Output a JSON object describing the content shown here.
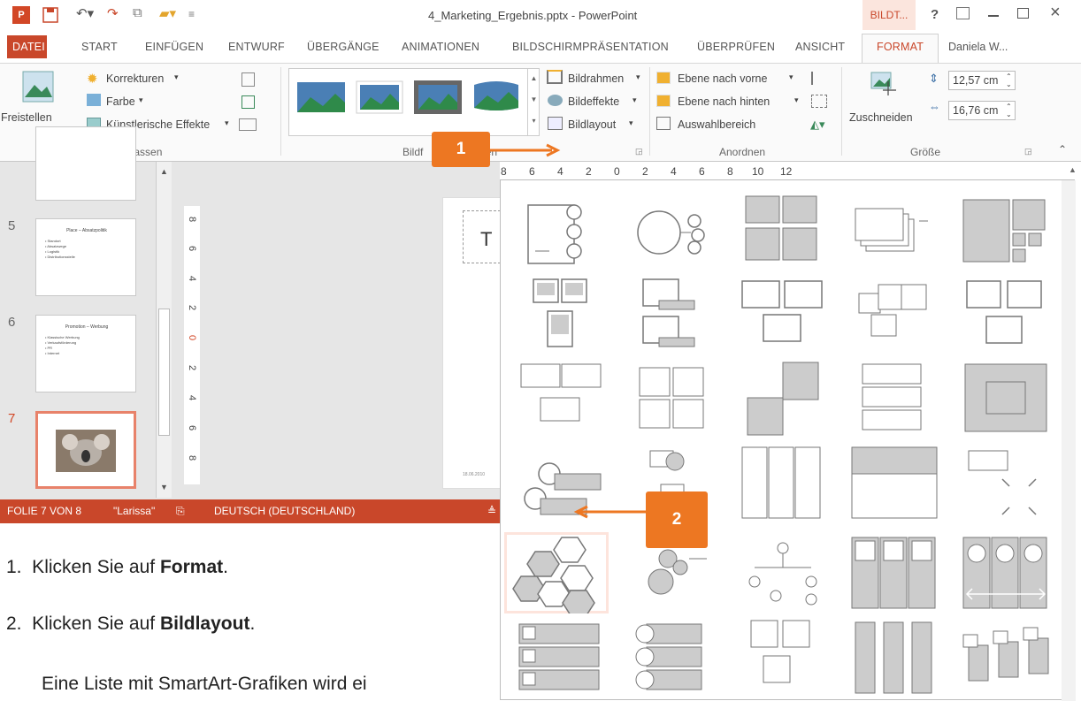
{
  "window": {
    "title": "4_Marketing_Ergebnis.pptx - PowerPoint",
    "context_tab": "BILDT...",
    "help": "?",
    "user": "Daniela W..."
  },
  "tabs": [
    "DATEI",
    "START",
    "EINFÜGEN",
    "ENTWURF",
    "ÜBERGÄNGE",
    "ANIMATIONEN",
    "BILDSCHIRMPRÄSENTATION",
    "ÜBERPRÜFEN",
    "ANSICHT",
    "FORMAT"
  ],
  "ribbon": {
    "freistellen": "Freistellen",
    "korrekturen": "Korrekturen",
    "farbe": "Farbe",
    "kuenstlerisch": "Künstlerische Effekte",
    "anpassen": "Anpassen",
    "bildrahmen": "Bildrahmen",
    "bildeffekte": "Bildeffekte",
    "bildlayout": "Bildlayout",
    "bildformat_left": "Bildf",
    "bildformat_right": "gen",
    "ebene_vorne": "Ebene nach vorne",
    "ebene_hinten": "Ebene nach hinten",
    "auswahlbereich": "Auswahlbereich",
    "anordnen": "Anordnen",
    "zuschneiden": "Zuschneiden",
    "height": "12,57 cm",
    "width": "16,76 cm",
    "groesse": "Größe"
  },
  "ruler": [
    "8",
    "6",
    "4",
    "2",
    "0",
    "2",
    "4",
    "6",
    "8",
    "10",
    "12"
  ],
  "vruler": [
    "8",
    "6",
    "4",
    "2",
    "0",
    "2",
    "4",
    "6",
    "8"
  ],
  "slides": [
    {
      "num": "5",
      "title": "Place – Absatzpolitik",
      "bullets": "• Standort\n• Absatzwege\n• Logistik\n• Distributionsstelle"
    },
    {
      "num": "6",
      "title": "Promotion – Werbung",
      "bullets": "• Klassische Werbung\n• Verkaufsförderung\n• PR\n• Internet"
    },
    {
      "num": "7",
      "title": "",
      "bullets": ""
    }
  ],
  "canvas": {
    "placeholder_letter": "T",
    "date": "18.06.2010"
  },
  "status": {
    "slide": "FOLIE 7 VON 8",
    "theme": "\"Larissa\"",
    "language": "DEUTSCH (DEUTSCHLAND)"
  },
  "callouts": {
    "one": "1",
    "two": "2"
  },
  "instructions": {
    "step1_pre": "1.  Klicken Sie auf ",
    "step1_bold": "Format",
    "step1_post": ".",
    "step2_pre": "2.  Klicken Sie auf ",
    "step2_bold": "Bildlayout",
    "step2_post": ".",
    "note": "Eine Liste mit SmartArt-Grafiken wird ei"
  },
  "colors": {
    "accent": "#c9472a",
    "callout": "#ed7722",
    "ribbon_bg": "#fafafa"
  }
}
